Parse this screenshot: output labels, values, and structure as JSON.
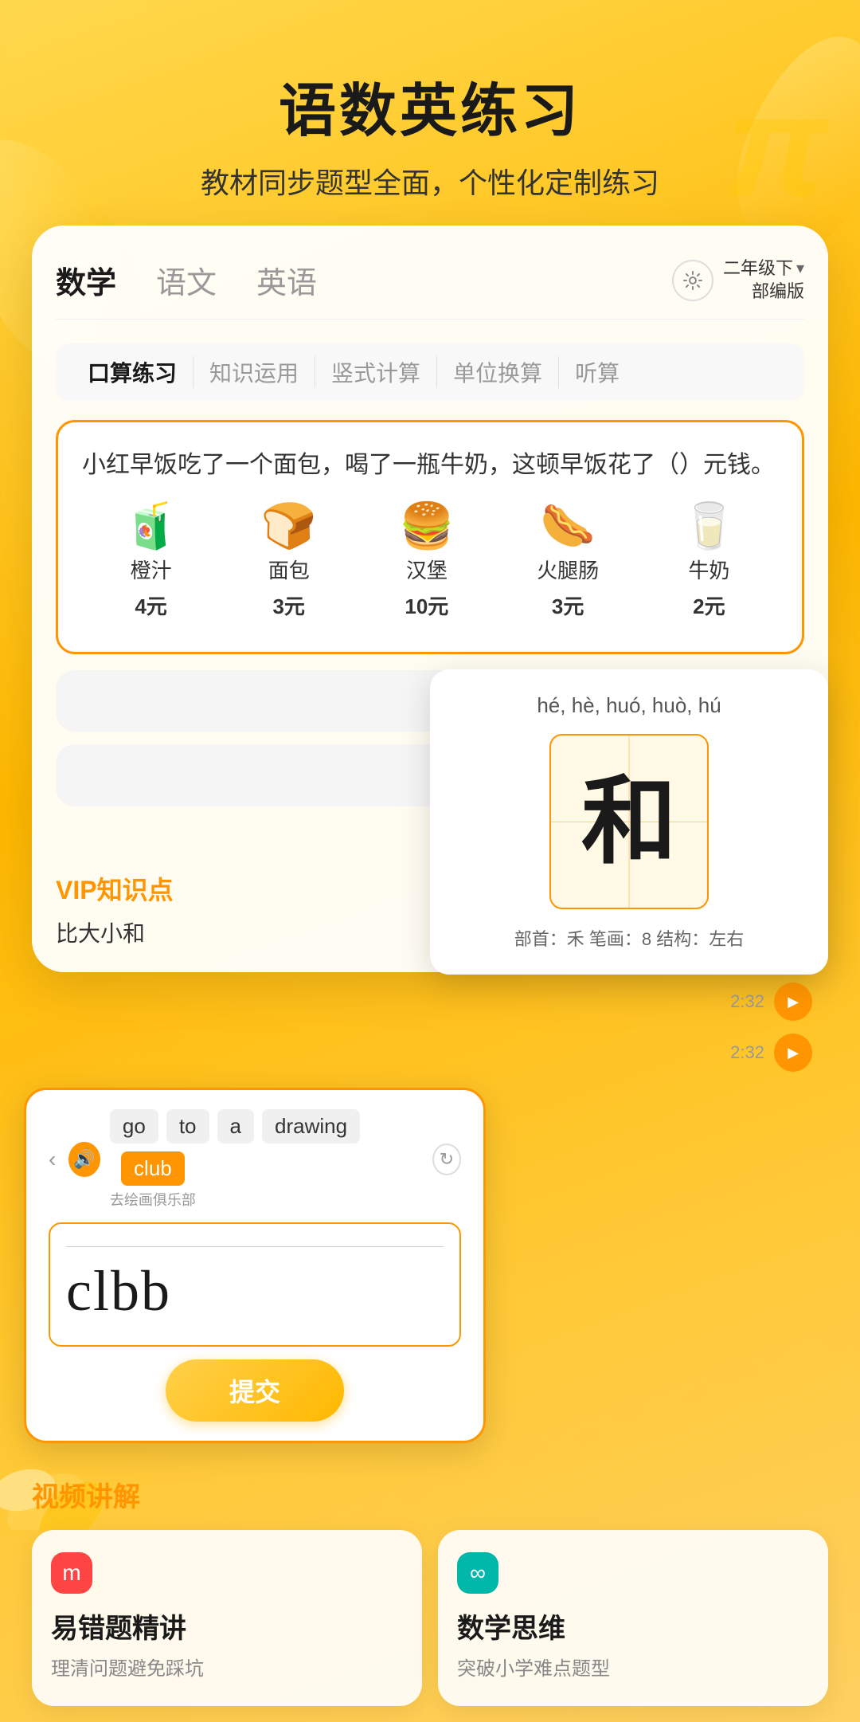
{
  "header": {
    "title": "语数英练习",
    "subtitle": "教材同步题型全面，个性化定制练习"
  },
  "tabs": {
    "items": [
      "数学",
      "语文",
      "英语"
    ],
    "active": "数学",
    "grade": "二年级下",
    "edition": "部编版"
  },
  "subtabs": {
    "items": [
      "口算练习",
      "知识运用",
      "竖式计算",
      "单位换算",
      "听算"
    ],
    "active": "口算练习"
  },
  "problem": {
    "text": "小红早饭吃了一个面包，喝了一瓶牛奶，这顿早饭花了（）元钱。",
    "foods": [
      {
        "emoji": "🧃",
        "name": "橙汁",
        "price": "4元"
      },
      {
        "emoji": "🍞",
        "name": "面包",
        "price": "3元"
      },
      {
        "emoji": "🍔",
        "name": "汉堡",
        "price": "10元"
      },
      {
        "emoji": "🌭",
        "name": "火腿肠",
        "price": "3元"
      },
      {
        "emoji": "🥛",
        "name": "牛奶",
        "price": "2元"
      }
    ]
  },
  "chinese_card": {
    "pinyin": "hé, hè, huó, huò, hú",
    "character": "和",
    "info": "部首：禾  笔画：8  结构：左右"
  },
  "vip": {
    "label": "VIP知识点",
    "sublabel": "比大小和"
  },
  "english_card": {
    "words": [
      {
        "text": "go",
        "type": "normal"
      },
      {
        "text": "to",
        "type": "normal"
      },
      {
        "text": "a",
        "type": "normal"
      },
      {
        "text": "drawing",
        "type": "normal"
      },
      {
        "text": "club",
        "type": "highlighted"
      }
    ],
    "hint_label": "去绘画俱乐部",
    "typed_text": "clbb",
    "submit_label": "提交"
  },
  "play_rows": [
    {
      "time": "2:32"
    },
    {
      "time": "2:32"
    }
  ],
  "video_label": "视频讲解",
  "bottom_cards": [
    {
      "icon": "m",
      "icon_color": "red",
      "title": "易错题精讲",
      "subtitle": "理清问题避免踩坑"
    },
    {
      "icon": "∞",
      "icon_color": "teal",
      "title": "数学思维",
      "subtitle": "突破小学难点题型"
    }
  ]
}
